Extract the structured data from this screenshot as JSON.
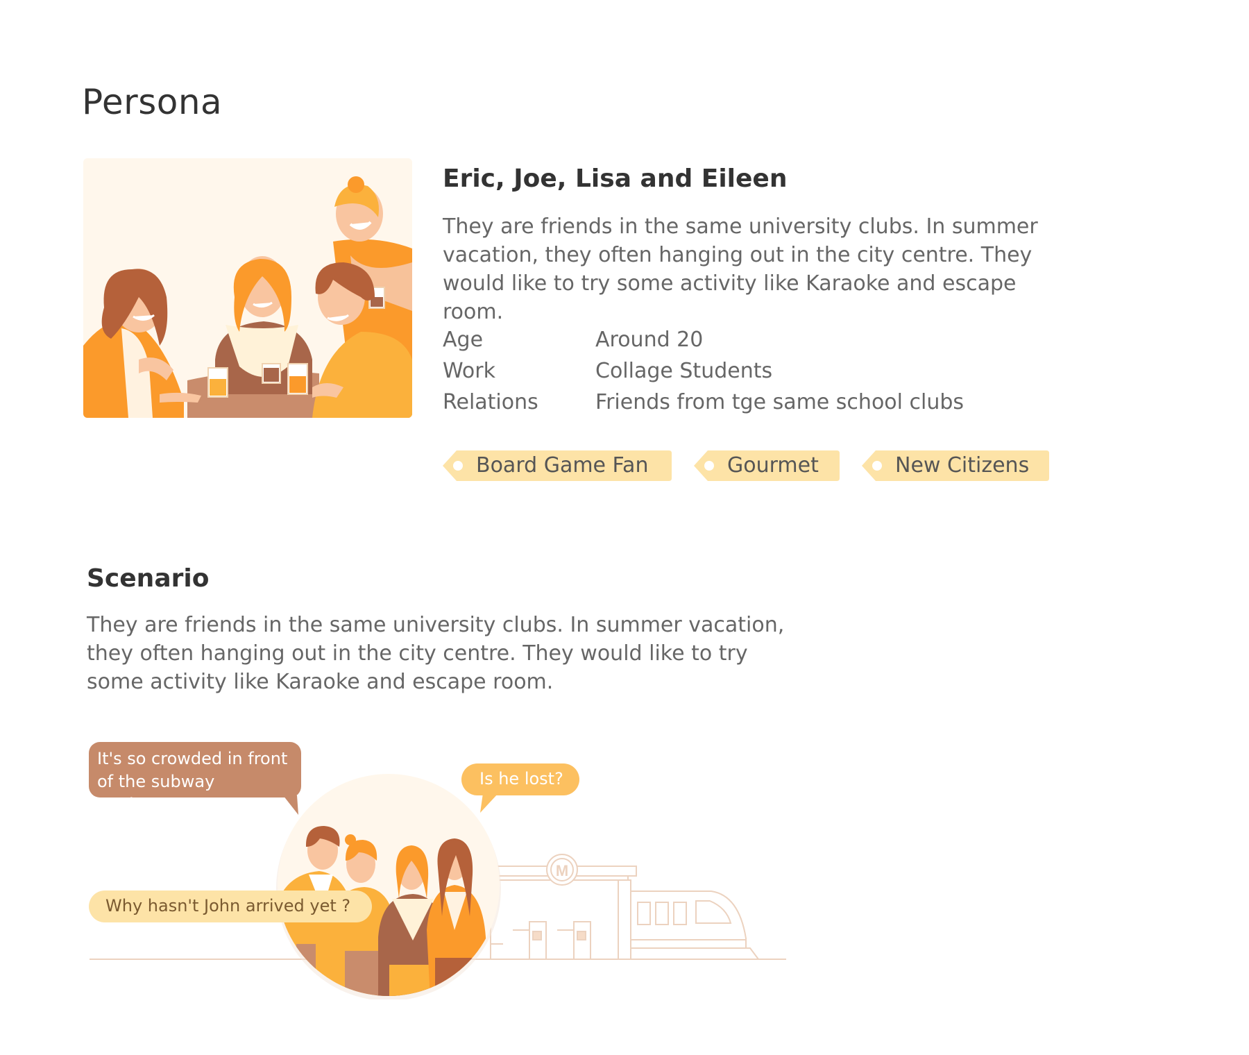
{
  "persona": {
    "title": "Persona",
    "name": "Eric, Joe, Lisa and Eileen",
    "description": "They are friends in the same university clubs. In summer vacation, they often hanging out in the city centre. They would like to try some activity like Karaoke and escape room.",
    "attributes": [
      {
        "label": "Age",
        "value": "Around 20"
      },
      {
        "label": "Work",
        "value": "Collage Students"
      },
      {
        "label": "Relations",
        "value": "Friends from tge same school clubs"
      }
    ],
    "tags": [
      "Board Game Fan",
      "Gourmet",
      "New Citizens"
    ]
  },
  "scenario": {
    "title": "Scenario",
    "description": "They are friends in the same university clubs. In summer vacation, they often hanging out in the city centre. They would like to try some activity like Karaoke and escape room.",
    "bubbles": {
      "crowded": "It's so crowded in front of the subway station...",
      "lost": "Is he lost?",
      "john": "Why hasn't John arrived yet ?"
    },
    "station_sign": "M"
  },
  "colors": {
    "tag_fill": "#fde3a7",
    "bubble_brown": "#c68a6a",
    "bubble_orange": "#fcc060",
    "bubble_cream": "#fde3a7",
    "illustration_bg": "#fff7ec"
  }
}
